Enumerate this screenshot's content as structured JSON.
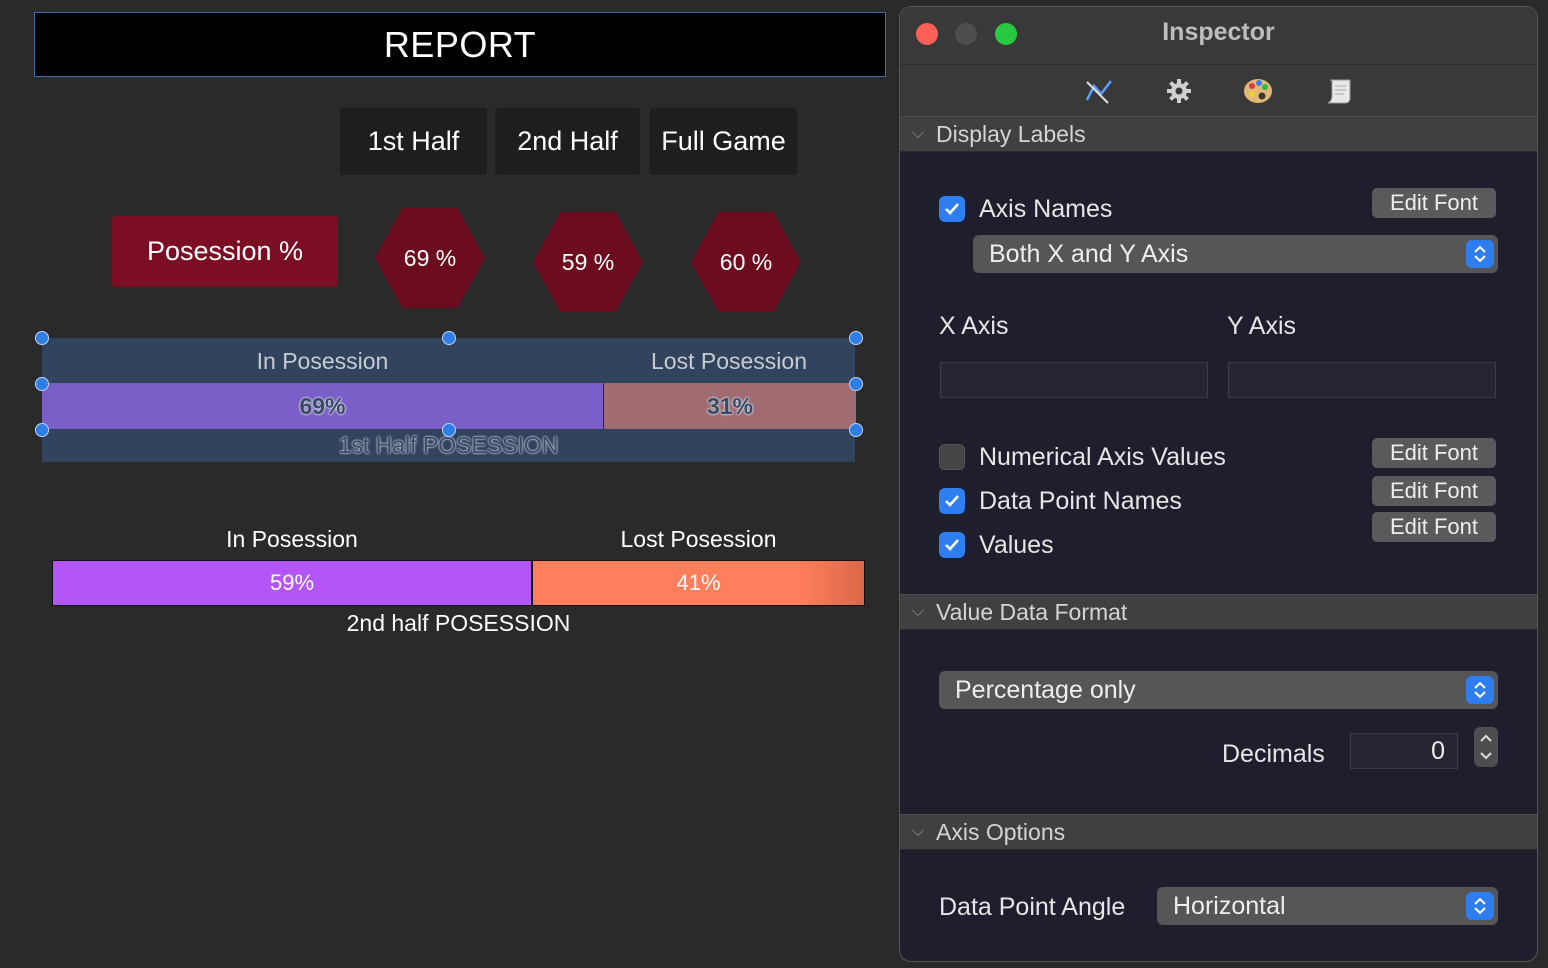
{
  "canvas": {
    "title": "REPORT",
    "tabs": [
      "1st Half",
      "2nd Half",
      "Full Game"
    ],
    "possession_label": "Posession %",
    "hexagons": [
      "69 %",
      "59 %",
      "60 %"
    ],
    "chart1": {
      "head_in": "In Posession",
      "head_lost": "Lost Posession",
      "val_in": "69%",
      "val_lost": "31%",
      "xlabel": "1st Half POSESSION",
      "color_in": "#7b5fc8",
      "color_lost": "#a16b72"
    },
    "chart2": {
      "head_in": "In Posession",
      "head_lost": "Lost Posession",
      "val_in": "59%",
      "val_lost": "41%",
      "xlabel": "2nd half POSESSION",
      "color_in": "#b455f7",
      "color_lost": "#ff7f5c"
    }
  },
  "chart_data": [
    {
      "type": "bar",
      "title": "",
      "xlabel": "1st Half POSESSION",
      "categories": [
        "In Posession",
        "Lost Posession"
      ],
      "values": [
        69,
        31
      ]
    },
    {
      "type": "bar",
      "title": "",
      "xlabel": "2nd half POSESSION",
      "categories": [
        "In Posession",
        "Lost Posession"
      ],
      "values": [
        59,
        41
      ]
    }
  ],
  "inspector": {
    "title": "Inspector",
    "toolbar_icons": [
      "chart-icon",
      "gear-icon",
      "palette-icon",
      "script-icon"
    ],
    "display_labels": {
      "header": "Display Labels",
      "axis_names": "Axis Names",
      "axis_names_checked": true,
      "edit_font": "Edit Font",
      "axis_select": "Both X and Y Axis",
      "x_axis": "X Axis",
      "y_axis": "Y Axis",
      "x_axis_value": "",
      "y_axis_value": "",
      "numerical_axis_values": "Numerical Axis Values",
      "numerical_checked": false,
      "data_point_names": "Data Point Names",
      "data_point_checked": true,
      "values": "Values",
      "values_checked": true
    },
    "value_data_format": {
      "header": "Value Data Format",
      "format_select": "Percentage only",
      "decimals_label": "Decimals",
      "decimals_value": "0"
    },
    "axis_options": {
      "header": "Axis Options",
      "angle_label": "Data Point Angle",
      "angle_select": "Horizontal"
    }
  }
}
